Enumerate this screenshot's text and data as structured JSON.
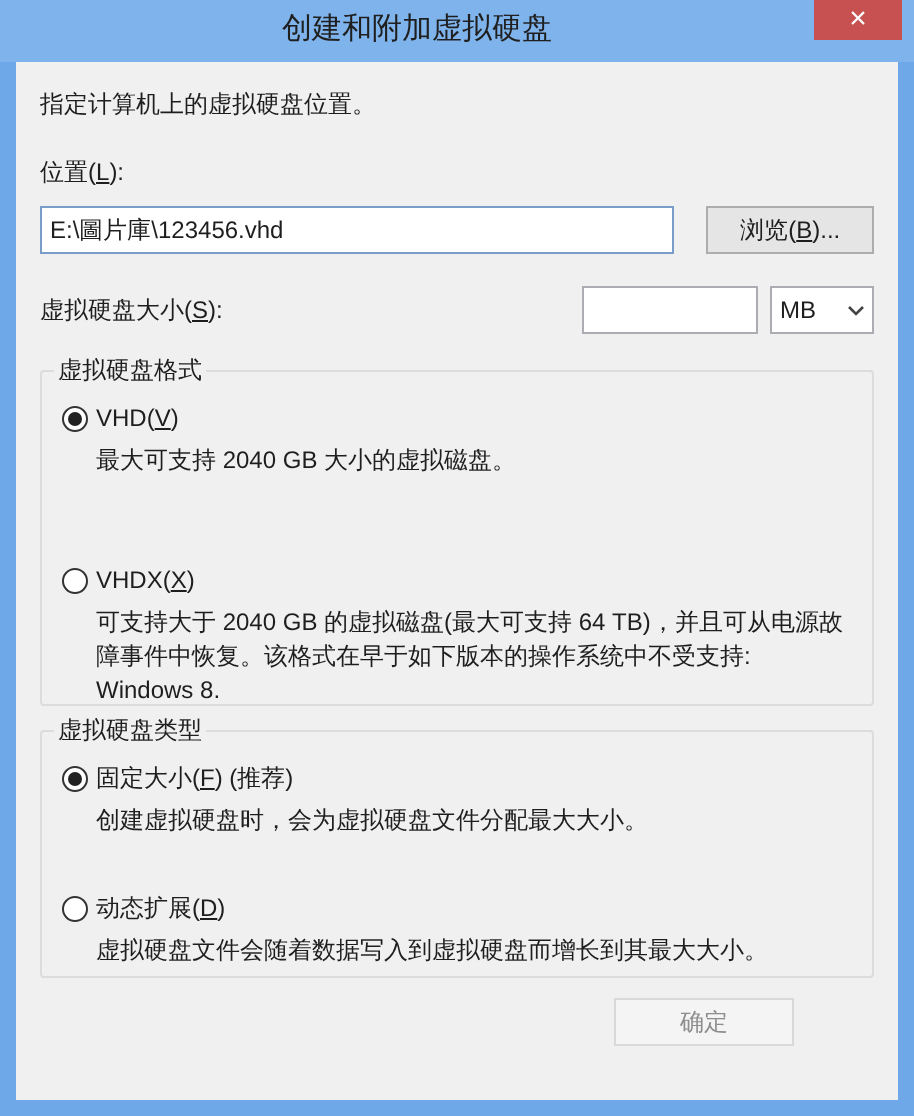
{
  "window": {
    "title": "创建和附加虚拟硬盘",
    "close": "×"
  },
  "intro": "指定计算机上的虚拟硬盘位置。",
  "location": {
    "label": [
      "位置(",
      "L",
      "):"
    ],
    "value": "E:\\圖片庫\\123456.vhd",
    "browse": [
      "浏览(",
      "B",
      ")..."
    ]
  },
  "size": {
    "label": [
      "虚拟硬盘大小(",
      "S",
      "):"
    ],
    "unit": "MB"
  },
  "groups": [
    {
      "title": "虚拟硬盘格式",
      "options": [
        {
          "label": [
            "VHD(",
            "V",
            ")"
          ],
          "selected": true,
          "description": "最大可支持 2040 GB 大小的虚拟磁盘。"
        },
        {
          "label": [
            "VHDX(",
            "X",
            ")"
          ],
          "selected": false,
          "description": "可支持大于 2040 GB 的虚拟磁盘(最大可支持 64 TB)，并且可从电源故障事件中恢复。该格式在早于如下版本的操作系统中不受支持: Windows 8."
        }
      ]
    },
    {
      "title": "虚拟硬盘类型",
      "options": [
        {
          "label": [
            "固定大小(",
            "F",
            ") (推荐)"
          ],
          "selected": true,
          "description": "创建虚拟硬盘时，会为虚拟硬盘文件分配最大大小。"
        },
        {
          "label": [
            "动态扩展(",
            "D",
            ")"
          ],
          "selected": false,
          "description": "虚拟硬盘文件会随着数据写入到虚拟硬盘而增长到其最大大小。"
        }
      ]
    }
  ],
  "buttons": [
    {
      "label": "确定",
      "disabled": true
    }
  ]
}
